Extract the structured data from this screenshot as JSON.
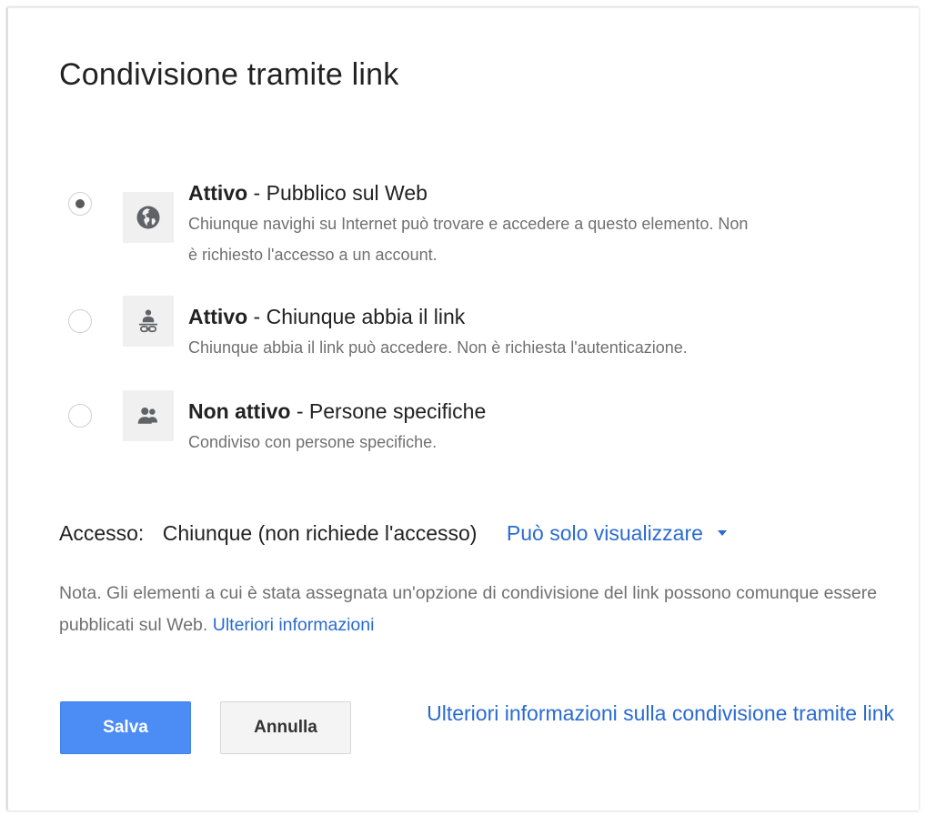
{
  "dialog": {
    "title": "Condivisione tramite link"
  },
  "options": [
    {
      "status": "Attivo",
      "separator": " - ",
      "label": "Pubblico sul Web",
      "description_line1": "Chiunque navighi su Internet può trovare e accedere a questo elemento. Non",
      "description_line2": "è richiesto l'accesso a un account.",
      "icon": "globe-icon",
      "checked": true
    },
    {
      "status": "Attivo",
      "separator": " - ",
      "label": "Chiunque abbia il link",
      "description_line1": "Chiunque abbia il link può accedere. Non è richiesta l'autenticazione.",
      "icon": "person-link-icon",
      "checked": false
    },
    {
      "status": "Non attivo",
      "separator": " - ",
      "label": "Persone specifiche",
      "description_line1": "Condiviso con persone specifiche.",
      "icon": "people-icon",
      "checked": false
    }
  ],
  "access": {
    "label": "Accesso:",
    "value": "Chiunque (non richiede l'accesso)",
    "permission": "Può solo visualizzare"
  },
  "note": {
    "text": "Nota. Gli elementi a cui è stata assegnata un'opzione di condivisione del link possono comunque essere pubblicati sul Web.",
    "link": "Ulteriori informazioni"
  },
  "buttons": {
    "save": "Salva",
    "cancel": "Annulla"
  },
  "more_link": "Ulteriori informazioni sulla condivisione tramite link",
  "colors": {
    "accent": "#4b8cf5",
    "link": "#2a6bd1",
    "text": "#222222",
    "muted": "#707070"
  }
}
